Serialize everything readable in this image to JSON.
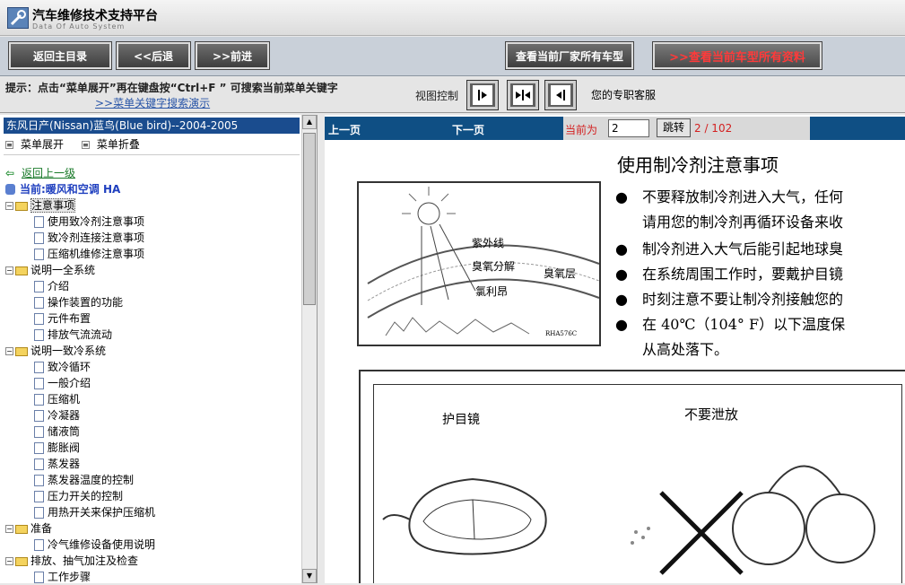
{
  "app": {
    "title": "汽车维修技术支持平台",
    "subtitle": "Data Of Auto System"
  },
  "toolbar": {
    "home": "返回主目录",
    "back": "<<后退",
    "forward": ">>前进",
    "all_models": "查看当前厂家所有车型",
    "all_data": ">>查看当前车型所有资料"
  },
  "hint": {
    "text": "提示：点击“菜单展开”再在键盘按“Ctrl+F ”  可搜索当前菜单关键字",
    "link": ">>菜单关键字搜索演示",
    "view_label": "视图控制",
    "service": "您的专职客服"
  },
  "left": {
    "car": "东风日产(Nissan)蓝鸟(Blue bird)--2004-2005",
    "expand": "菜单展开",
    "collapse": "菜单折叠",
    "back": "返回上一级",
    "current": "当前:暖风和空调  HA",
    "tree": [
      {
        "type": "folder",
        "label": "注意事项",
        "selected": true
      },
      {
        "type": "doc",
        "label": "使用致冷剂注意事项"
      },
      {
        "type": "doc",
        "label": "致冷剂连接注意事项"
      },
      {
        "type": "doc",
        "label": "压缩机维修注意事项"
      },
      {
        "type": "folder",
        "label": "说明一全系统"
      },
      {
        "type": "doc",
        "label": "介绍"
      },
      {
        "type": "doc",
        "label": "操作装置的功能"
      },
      {
        "type": "doc",
        "label": "元件布置"
      },
      {
        "type": "doc",
        "label": "排放气流流动"
      },
      {
        "type": "folder",
        "label": "说明一致冷系统"
      },
      {
        "type": "doc",
        "label": "致冷循环"
      },
      {
        "type": "doc",
        "label": "一般介绍"
      },
      {
        "type": "doc",
        "label": "压缩机"
      },
      {
        "type": "doc",
        "label": "冷凝器"
      },
      {
        "type": "doc",
        "label": "储液筒"
      },
      {
        "type": "doc",
        "label": "膨胀阀"
      },
      {
        "type": "doc",
        "label": "蒸发器"
      },
      {
        "type": "doc",
        "label": "蒸发器温度的控制"
      },
      {
        "type": "doc",
        "label": "压力开关的控制"
      },
      {
        "type": "doc",
        "label": "用热开关来保护压缩机"
      },
      {
        "type": "folder",
        "label": "准备"
      },
      {
        "type": "doc",
        "label": "冷气维修设备使用说明"
      },
      {
        "type": "folder",
        "label": "排放、抽气加注及检查"
      },
      {
        "type": "doc",
        "label": "工作步骤"
      }
    ]
  },
  "right": {
    "prev": "上一页",
    "next": "下一页",
    "current_label": "当前为",
    "page_value": "2",
    "go": "跳转",
    "page_info": "2 / 102"
  },
  "document": {
    "title": "使用制冷剂注意事项",
    "bullets": [
      "不要释放制冷剂进入大气，任何",
      "请用您的制冷剂再循环设备来收",
      "制冷剂进入大气后能引起地球臭",
      "在系统周围工作时，要戴护目镜",
      "时刻注意不要让制冷剂接触您的",
      "在 40℃（104° F）以下温度保",
      "从高处落下。"
    ],
    "fig1_labels": [
      "紫外线",
      "臭氧分解",
      "臭氧层",
      "氯利昂",
      "RHA576C"
    ],
    "fig2_labels": [
      "护目镜",
      "不要泄放"
    ]
  }
}
